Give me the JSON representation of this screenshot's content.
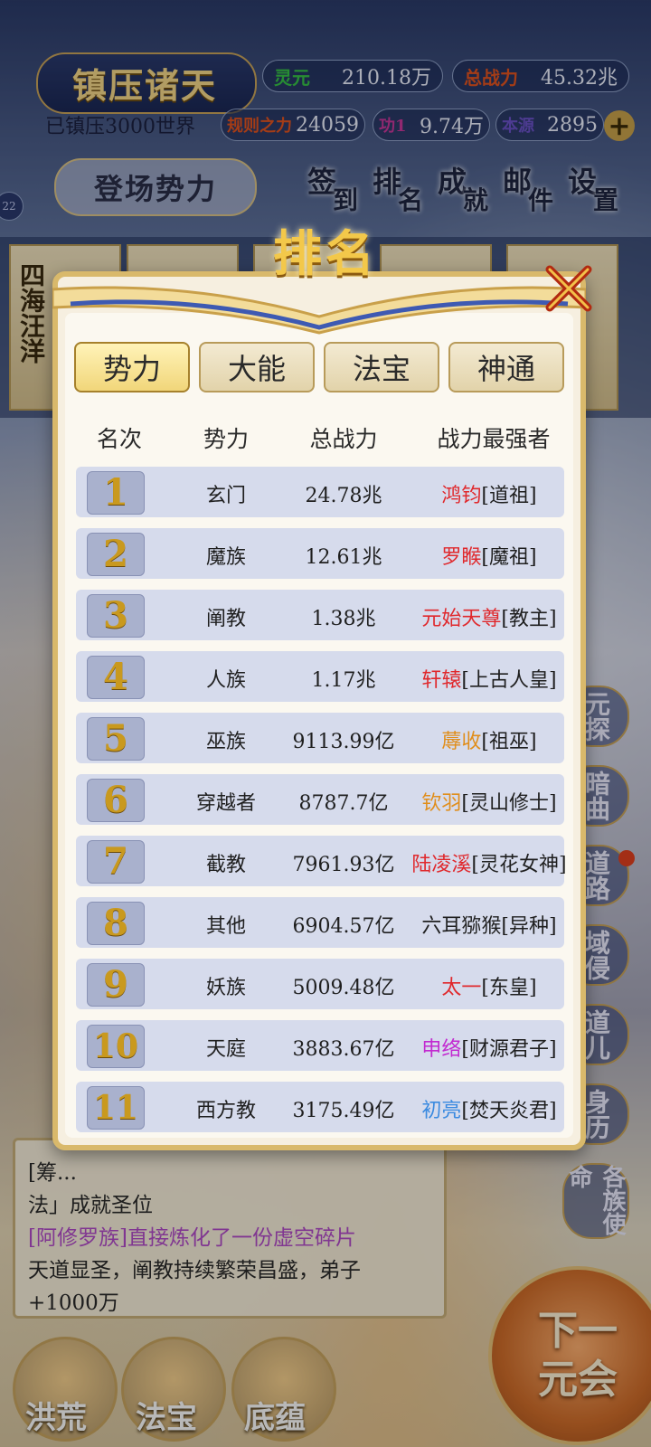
{
  "hud": {
    "title": "镇压诸天",
    "world_status": "已镇压3000世界",
    "stats": [
      {
        "label": "灵元",
        "value": "210.18万",
        "color": "#37c247"
      },
      {
        "label": "总战力",
        "value": "45.32兆",
        "color": "#e3541f"
      },
      {
        "label": "规则之力",
        "value": "24059",
        "color": "#e3541f"
      },
      {
        "label": "功1",
        "value": "9.74万",
        "color": "#c9389c"
      },
      {
        "label": "本源",
        "value": "2895",
        "color": "#6b52c9"
      }
    ],
    "plus": "+",
    "deploy_button": "登场势力",
    "menu": [
      {
        "a": "签",
        "b": "到"
      },
      {
        "a": "排",
        "b": "名"
      },
      {
        "a": "成",
        "b": "就"
      },
      {
        "a": "邮",
        "b": "件"
      },
      {
        "a": "设",
        "b": "置"
      }
    ],
    "tiny_badge": "22"
  },
  "background": {
    "card_text": "四海汪洋",
    "side_menu": [
      "元探",
      "暗曲",
      "道路",
      "域侵",
      "道儿",
      "身历",
      "各族使命"
    ],
    "log": [
      {
        "text": "[筹...",
        "style": "normal"
      },
      {
        "text": "法」成就圣位",
        "style": "normal"
      },
      {
        "text": "[阿修罗族]直接炼化了一份虚空碎片",
        "style": "purple"
      },
      {
        "text": "天道显圣，阐教持续繁荣昌盛，弟子",
        "style": "normal"
      },
      {
        "text": "+1000万",
        "style": "normal"
      }
    ],
    "bottom_nav": [
      "洪荒",
      "法宝",
      "底蕴"
    ],
    "next_button": [
      "下一",
      "元会"
    ]
  },
  "modal": {
    "title": "排名",
    "tabs": [
      "势力",
      "大能",
      "法宝",
      "神通"
    ],
    "active_tab": 0,
    "headers": [
      "名次",
      "势力",
      "总战力",
      "战力最强者"
    ],
    "rows": [
      {
        "rank": "1",
        "faction": "玄门",
        "power": "24.78兆",
        "champion": "鸿钧",
        "title": "[道祖]",
        "color": "#e0282c"
      },
      {
        "rank": "2",
        "faction": "魔族",
        "power": "12.61兆",
        "champion": "罗睺",
        "title": "[魔祖]",
        "color": "#e0282c"
      },
      {
        "rank": "3",
        "faction": "阐教",
        "power": "1.38兆",
        "champion": "元始天尊",
        "title": "[教主]",
        "color": "#e0282c"
      },
      {
        "rank": "4",
        "faction": "人族",
        "power": "1.17兆",
        "champion": "轩辕",
        "title": "[上古人皇]",
        "color": "#e0282c"
      },
      {
        "rank": "5",
        "faction": "巫族",
        "power": "9113.99亿",
        "champion": "蓐收",
        "title": "[祖巫]",
        "color": "#e08e1c"
      },
      {
        "rank": "6",
        "faction": "穿越者",
        "power": "8787.7亿",
        "champion": "钦羽",
        "title": "[灵山修士]",
        "color": "#e08e1c"
      },
      {
        "rank": "7",
        "faction": "截教",
        "power": "7961.93亿",
        "champion": "陆凌溪",
        "title": "[灵花女神]",
        "color": "#e0282c"
      },
      {
        "rank": "8",
        "faction": "其他",
        "power": "6904.57亿",
        "champion": "六耳猕猴",
        "title": "[异种]",
        "color": "#1f1f1f"
      },
      {
        "rank": "9",
        "faction": "妖族",
        "power": "5009.48亿",
        "champion": "太一",
        "title": "[东皇]",
        "color": "#e0282c"
      },
      {
        "rank": "10",
        "faction": "天庭",
        "power": "3883.67亿",
        "champion": "申络",
        "title": "[财源君子]",
        "color": "#c22ad0"
      },
      {
        "rank": "11",
        "faction": "西方教",
        "power": "3175.49亿",
        "champion": "初亮",
        "title": "[焚天炎君]",
        "color": "#3a8ae0"
      }
    ]
  }
}
